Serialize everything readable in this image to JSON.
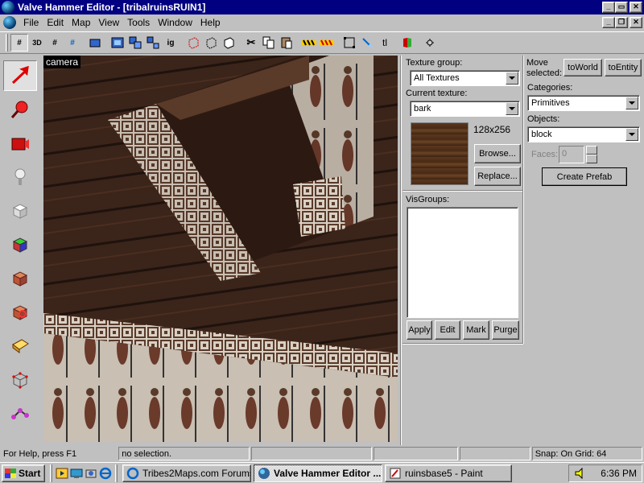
{
  "window": {
    "title": "Valve Hammer Editor - [tribalruinsRUIN1]",
    "caption_buttons": [
      "_",
      "▭",
      "✕"
    ],
    "doc_caption_buttons": [
      "_",
      "❐",
      "✕"
    ]
  },
  "menu": [
    "File",
    "Edit",
    "Map",
    "View",
    "Tools",
    "Window",
    "Help"
  ],
  "toolbar": {
    "buttons": [
      {
        "name": "grid-toggle",
        "glyph": "#"
      },
      {
        "name": "3d-grid",
        "glyph": "3D"
      },
      {
        "name": "smaller-grid",
        "glyph": "#"
      },
      {
        "name": "larger-grid",
        "glyph": "#"
      },
      {
        "name": "load-window-state",
        "glyph": ""
      },
      {
        "name": "save-window-state",
        "glyph": ""
      },
      {
        "name": "carve",
        "glyph": ""
      },
      {
        "name": "group",
        "glyph": ""
      },
      {
        "name": "ungroup",
        "glyph": ""
      },
      {
        "name": "ignore-groups",
        "glyph": "ig"
      },
      {
        "name": "hide-selected",
        "glyph": ""
      },
      {
        "name": "hide-unselected",
        "glyph": ""
      },
      {
        "name": "show-all",
        "glyph": ""
      },
      {
        "name": "cut",
        "glyph": "✂"
      },
      {
        "name": "copy",
        "glyph": ""
      },
      {
        "name": "paste",
        "glyph": ""
      },
      {
        "name": "toggle-texture-lock",
        "glyph": ""
      },
      {
        "name": "toggle-texture-scaling",
        "glyph": ""
      },
      {
        "name": "texture-application",
        "glyph": ""
      },
      {
        "name": "decals",
        "glyph": ""
      },
      {
        "name": "transform",
        "glyph": "tl"
      },
      {
        "name": "run-map",
        "glyph": ""
      },
      {
        "name": "entity-report",
        "glyph": ""
      }
    ]
  },
  "viewport": {
    "label": "camera"
  },
  "texture_panel": {
    "group_label": "Texture group:",
    "group_value": "All Textures",
    "current_label": "Current texture:",
    "current_value": "bark",
    "size": "128x256",
    "browse": "Browse...",
    "replace": "Replace..."
  },
  "visgroups": {
    "label": "VisGroups:",
    "apply": "Apply",
    "edit": "Edit",
    "mark": "Mark",
    "purge": "Purge"
  },
  "object_panel": {
    "move_selected": "Move selected:",
    "to_world": "toWorld",
    "to_entity": "toEntity",
    "categories_label": "Categories:",
    "categories_value": "Primitives",
    "objects_label": "Objects:",
    "objects_value": "block",
    "faces_label": "Faces:",
    "faces_value": "0",
    "create_prefab": "Create Prefab"
  },
  "statusbar": {
    "help": "For Help, press F1",
    "selection": "no selection.",
    "snap": "Snap: On Grid: 64"
  },
  "taskbar": {
    "start": "Start",
    "tasks": [
      {
        "label": "Tribes2Maps.com Forums -...",
        "active": false
      },
      {
        "label": "Valve Hammer Editor ...",
        "active": true
      },
      {
        "label": "ruinsbase5 - Paint",
        "active": false
      }
    ],
    "clock": "6:36 PM"
  },
  "colors": {
    "titlebar": "#000080",
    "face": "#c0c0c0"
  }
}
